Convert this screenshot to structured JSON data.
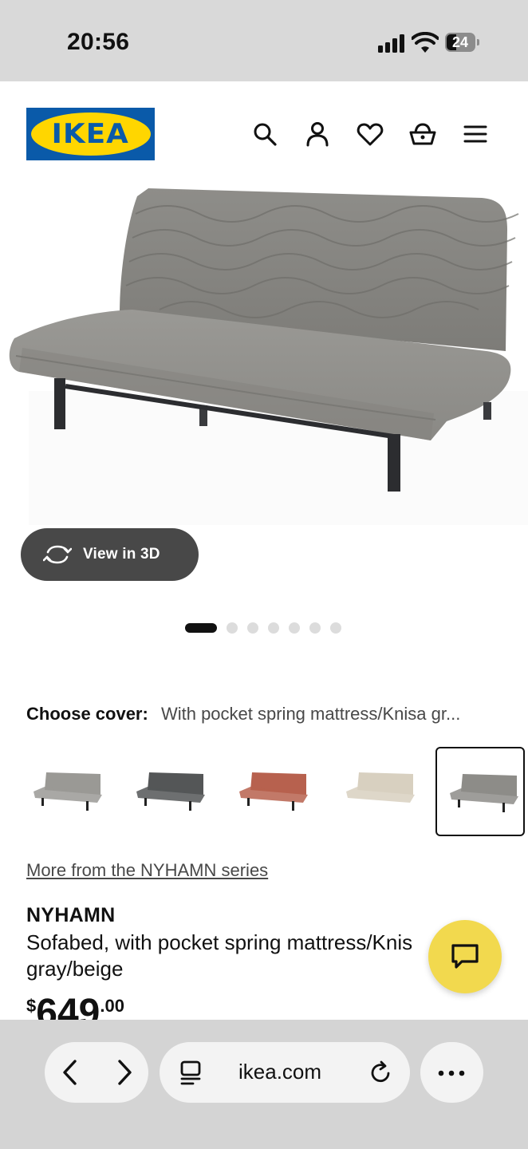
{
  "status_bar": {
    "time": "20:56",
    "battery": "24"
  },
  "header": {
    "logo_text": "IKEA",
    "icons": [
      "search-icon",
      "account-icon",
      "heart-icon",
      "basket-icon",
      "menu-icon"
    ],
    "brand_blue": "#0a5aa9",
    "brand_yellow": "#ffd600"
  },
  "gallery": {
    "view_3d_label": "View in 3D",
    "total_images": 7,
    "active_index": 0
  },
  "cover": {
    "label": "Choose cover:",
    "value": "With pocket spring mattress/Knisa gr...",
    "swatch_colors": [
      "#9a9995",
      "#545657",
      "#b7614e",
      "#d8d0c0",
      "#8d8c88"
    ],
    "selected_index": 4
  },
  "series_link": "More from the NYHAMN series",
  "product": {
    "name": "NYHAMN",
    "description": "Sofabed, with pocket spring mattress/Knis gray/beige",
    "price_currency": "$",
    "price_integer": "649",
    "price_decimals": ".00"
  },
  "chat_button": {
    "icon": "chat-icon",
    "color": "#f2d94e"
  },
  "browser": {
    "url": "ikea.com",
    "back_icon": "chevron-left-icon",
    "forward_icon": "chevron-right-icon",
    "tabs_icon": "tabs-icon",
    "reload_icon": "reload-icon",
    "more_icon": "more-icon"
  }
}
